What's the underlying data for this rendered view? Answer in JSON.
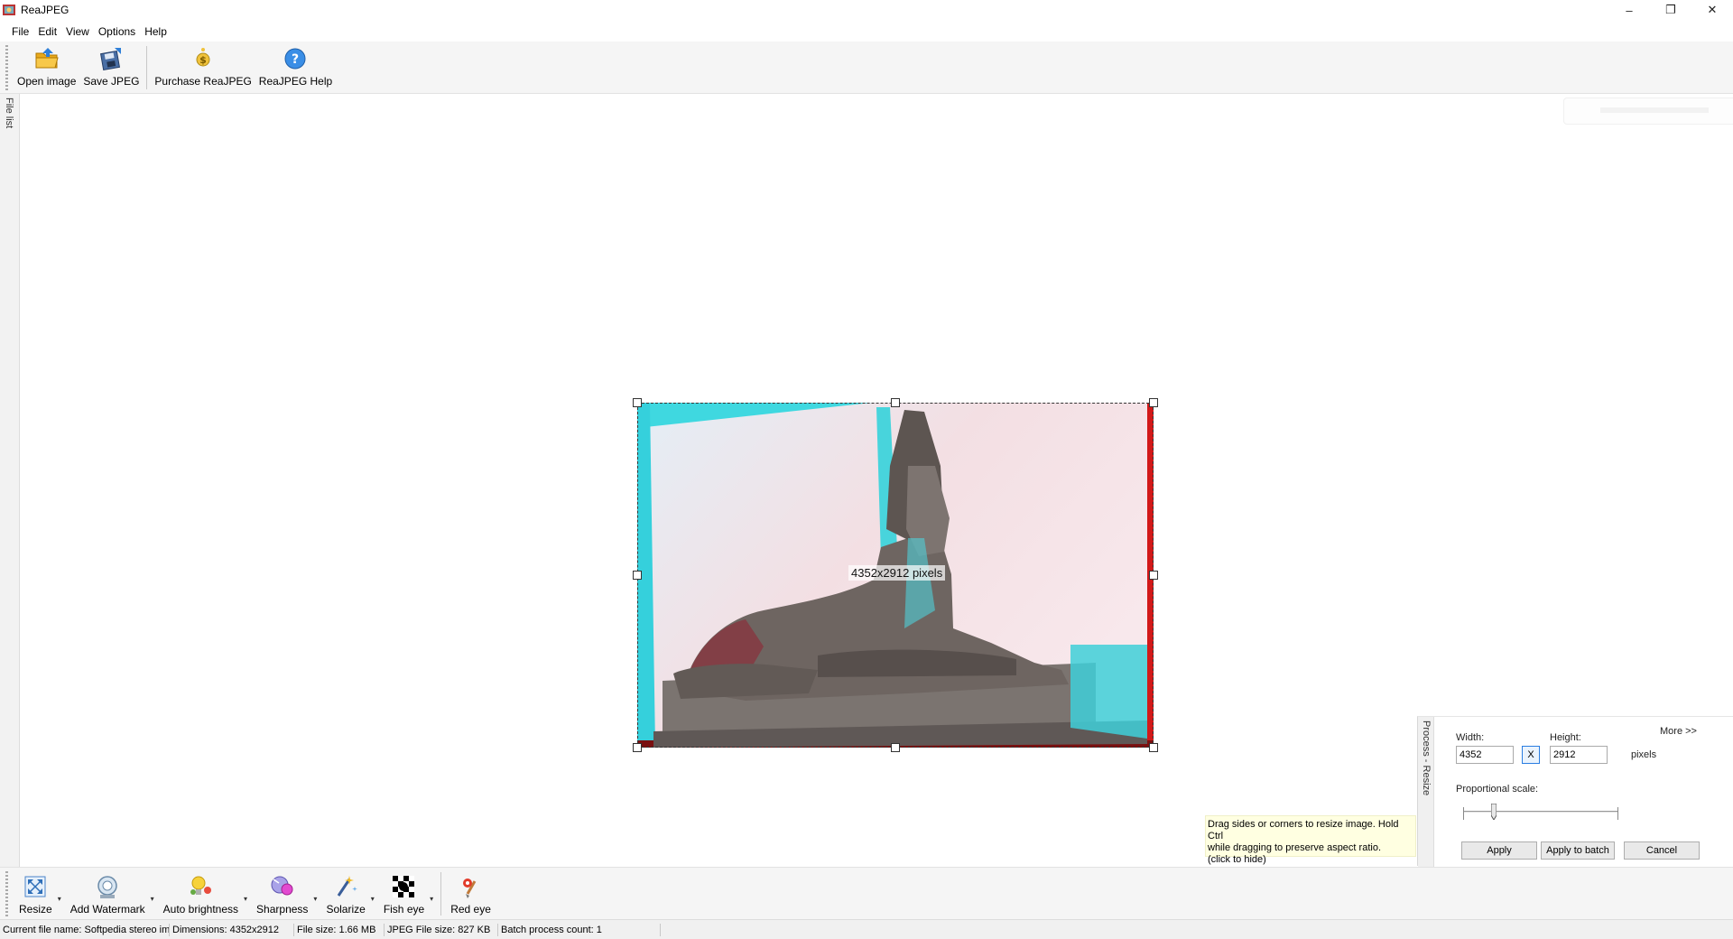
{
  "window": {
    "title": "ReaJPEG",
    "minimize": "–",
    "restore": "❐",
    "close": "✕"
  },
  "menu": {
    "items": [
      "File",
      "Edit",
      "View",
      "Options",
      "Help"
    ]
  },
  "toolbar": {
    "open_image": "Open image",
    "save_jpeg": "Save JPEG",
    "purchase": "Purchase ReaJPEG",
    "help": "ReaJPEG Help"
  },
  "sidebar": {
    "file_list": "File list"
  },
  "canvas": {
    "dimension_overlay": "4352x2912 pixels"
  },
  "hint": {
    "line1": "Drag sides or corners to resize image. Hold Ctrl",
    "line2": "while dragging to preserve aspect ratio.",
    "line3": "(click to hide)"
  },
  "process_panel": {
    "tab_label": "Process - Resize",
    "more": "More >>",
    "width_label": "Width:",
    "height_label": "Height:",
    "width_value": "4352",
    "height_value": "2912",
    "lock_label": "X",
    "units": "pixels",
    "proportional_label": "Proportional scale:",
    "proportional_value": 0.2,
    "apply": "Apply",
    "apply_batch": "Apply to batch",
    "cancel": "Cancel"
  },
  "bottom_toolbar": {
    "resize": "Resize",
    "watermark": "Add Watermark",
    "auto_brightness": "Auto brightness",
    "sharpness": "Sharpness",
    "solarize": "Solarize",
    "fish_eye": "Fish eye",
    "red_eye": "Red eye",
    "dropdown_glyph": "▾"
  },
  "status": {
    "file_name": "Current file name:  Softpedia stereo im",
    "dimensions": "Dimensions:  4352x2912",
    "file_size": "File size:  1.66 MB",
    "jpeg_size": "JPEG File size:  827 KB",
    "batch_count": "Batch process count:  1"
  },
  "colors": {
    "selection_border": "#333333",
    "hint_bg": "#ffffe1",
    "toolbar_bg": "#f5f5f5",
    "accent": "#2a7de1"
  }
}
